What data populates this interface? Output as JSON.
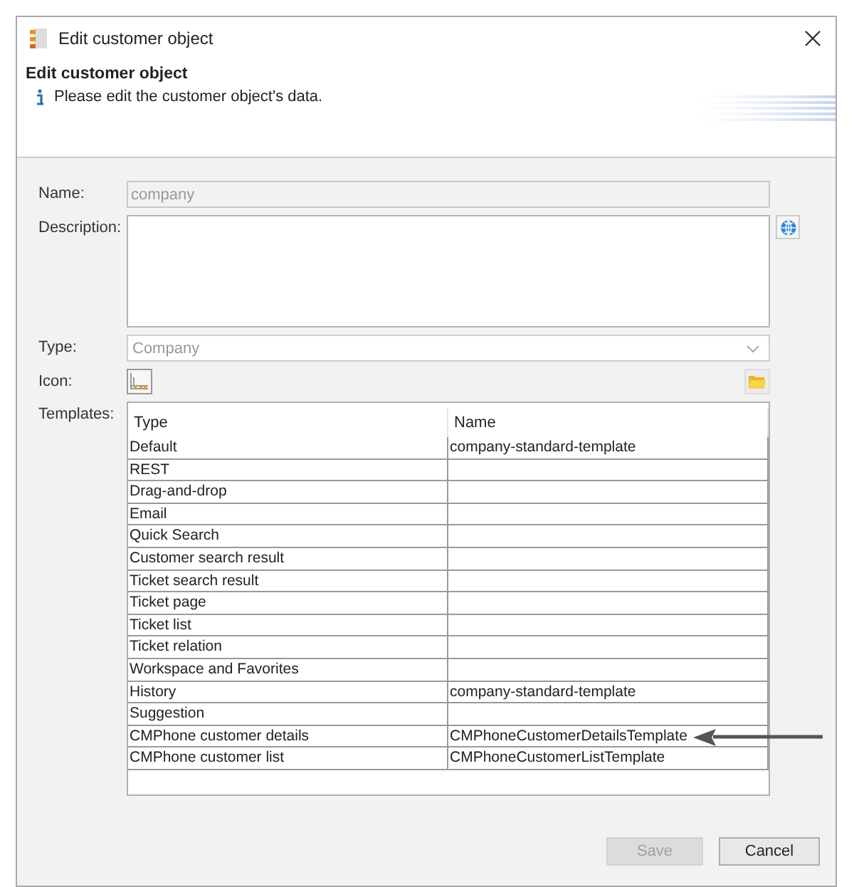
{
  "window": {
    "title": "Edit customer object"
  },
  "header": {
    "title": "Edit customer object",
    "info": "Please edit the customer object's data."
  },
  "form": {
    "name": {
      "label": "Name:",
      "value": "company",
      "disabled": true
    },
    "description": {
      "label": "Description:"
    },
    "type": {
      "label": "Type:",
      "value": "Company",
      "disabled": true
    },
    "icon": {
      "label": "Icon:"
    },
    "templates": {
      "label": "Templates:",
      "columns": [
        "Type",
        "Name"
      ],
      "rows": [
        {
          "type": "Default",
          "name": "company-standard-template",
          "marked": false
        },
        {
          "type": "REST",
          "name": "",
          "marked": false
        },
        {
          "type": "Drag-and-drop",
          "name": "",
          "marked": false
        },
        {
          "type": "Email",
          "name": "",
          "marked": false
        },
        {
          "type": "Quick Search",
          "name": "",
          "marked": false
        },
        {
          "type": "Customer search result",
          "name": "",
          "marked": false
        },
        {
          "type": "Ticket search result",
          "name": "",
          "marked": false
        },
        {
          "type": "Ticket page",
          "name": "",
          "marked": false
        },
        {
          "type": "Ticket list",
          "name": "",
          "marked": false
        },
        {
          "type": "Ticket relation",
          "name": "",
          "marked": false
        },
        {
          "type": "Workspace and Favorites",
          "name": "",
          "marked": false
        },
        {
          "type": "History",
          "name": "company-standard-template",
          "marked": false
        },
        {
          "type": "Suggestion",
          "name": "",
          "marked": false
        },
        {
          "type": "CMPhone customer details",
          "name": "CMPhoneCustomerDetailsTemplate",
          "marked": true
        },
        {
          "type": "CMPhone customer list",
          "name": "CMPhoneCustomerListTemplate",
          "marked": false
        }
      ]
    }
  },
  "buttons": [
    {
      "label": "Save",
      "disabled": true
    },
    {
      "label": "Cancel",
      "disabled": false
    }
  ]
}
